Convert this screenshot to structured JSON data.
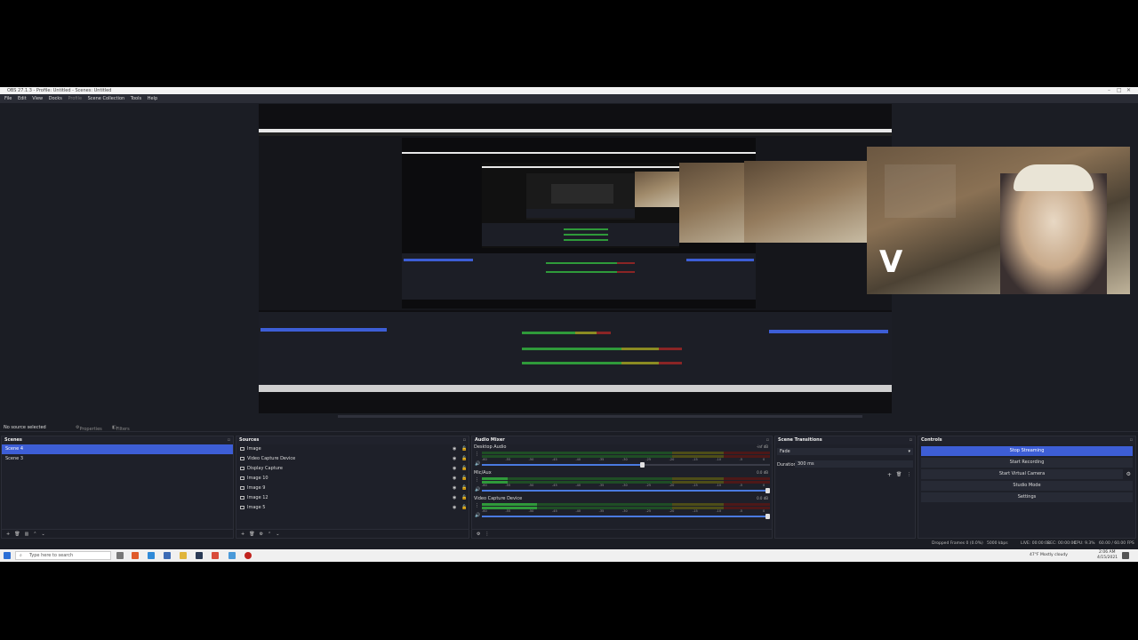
{
  "window": {
    "title": "OBS 27.1.3 - Profile: Untitled - Scenes: Untitled",
    "menu": [
      "File",
      "Edit",
      "View",
      "Docks",
      "Profile",
      "Scene Collection",
      "Tools",
      "Help"
    ]
  },
  "preview_bar": {
    "no_source": "No source selected",
    "properties": "Properties",
    "filters": "Filters"
  },
  "scenes": {
    "title": "Scenes",
    "items": [
      {
        "label": "Scene 4",
        "selected": true
      },
      {
        "label": "Scene 3",
        "selected": false
      }
    ]
  },
  "sources": {
    "title": "Sources",
    "items": [
      "Image",
      "Video Capture Device",
      "Display Capture",
      "Image 10",
      "Image 9",
      "Image 12",
      "Image 5"
    ]
  },
  "audio_mixer": {
    "title": "Audio Mixer",
    "channels": [
      {
        "name": "Desktop Audio",
        "db": "-inf dB",
        "level": 0.0,
        "volume": 0.55
      },
      {
        "name": "Mic/Aux",
        "db": "0.0 dB",
        "level": 0.09,
        "volume": 1.0
      },
      {
        "name": "Video Capture Device",
        "db": "0.0 dB",
        "level": 0.19,
        "volume": 1.0
      }
    ],
    "ticks": [
      "-60",
      "-55",
      "-50",
      "-45",
      "-40",
      "-35",
      "-30",
      "-25",
      "-20",
      "-15",
      "-10",
      "-5",
      "0"
    ]
  },
  "transitions": {
    "title": "Scene Transitions",
    "type": "Fade",
    "duration_label": "Duration",
    "duration_value": "300 ms"
  },
  "controls": {
    "title": "Controls",
    "buttons": [
      {
        "label": "Stop Streaming",
        "active": true
      },
      {
        "label": "Start Recording",
        "active": false
      },
      {
        "label": "Start Virtual Camera",
        "active": false
      },
      {
        "label": "Studio Mode",
        "active": false
      },
      {
        "label": "Settings",
        "active": false
      }
    ]
  },
  "status": {
    "dropped": "Dropped Frames 0 (0.0%)",
    "bitrate": "5000 kbps",
    "live": "LIVE: 00:00:02",
    "rec": "REC: 00:00:00",
    "cpu": "CPU: 9.3%",
    "fps": "60.00 / 60.00 FPS"
  },
  "taskbar": {
    "search_placeholder": "Type here to search",
    "weather": "47°F  Mostly cloudy",
    "time": "2:06 AM",
    "date": "4/15/2021"
  },
  "colors": {
    "accent": "#3d5ed6",
    "meter_green": "#2f9a3a",
    "meter_yellow": "#8b8b22",
    "meter_red": "#8a2525"
  }
}
